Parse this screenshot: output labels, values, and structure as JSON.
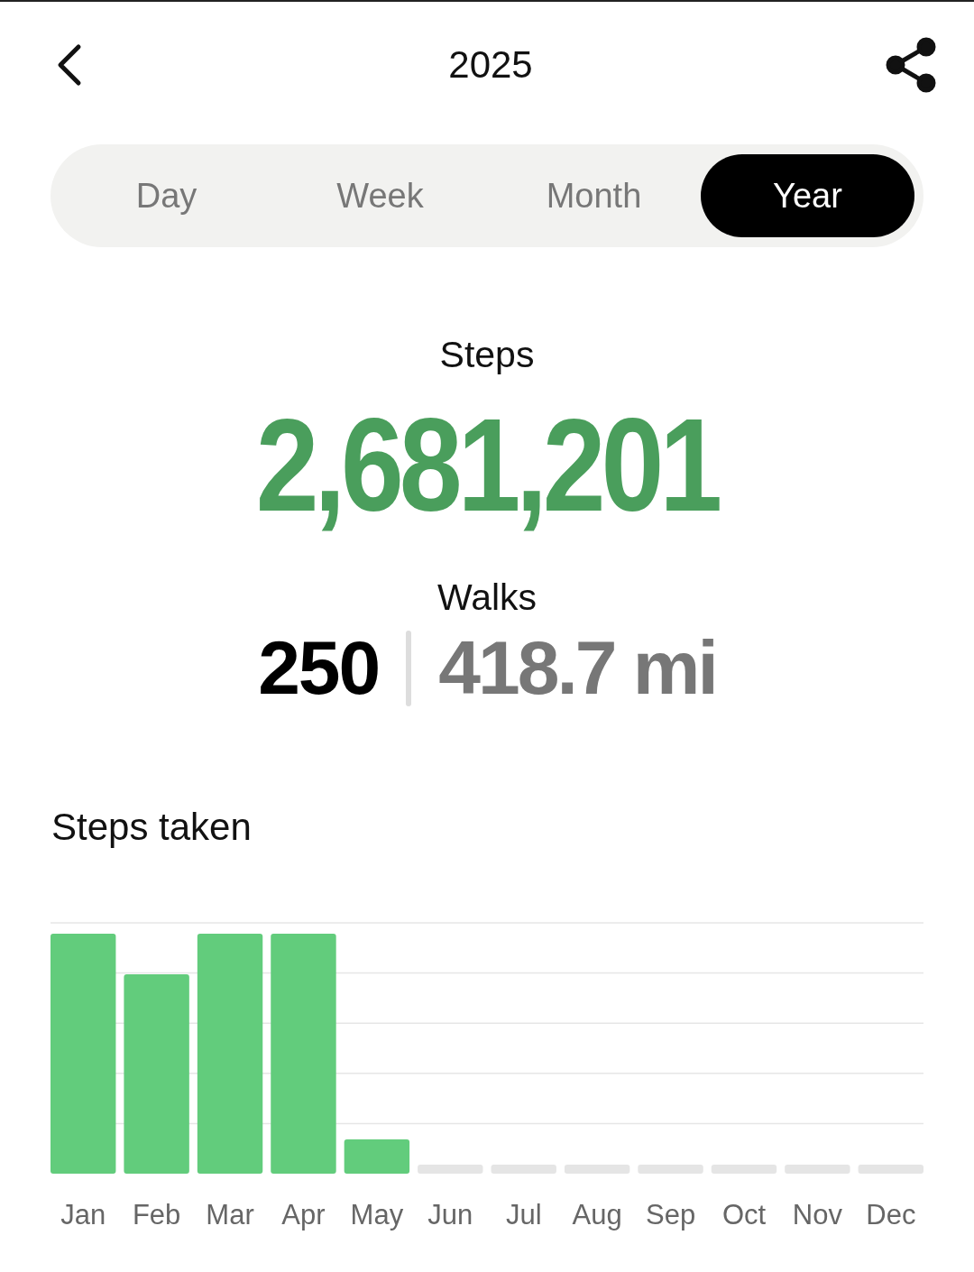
{
  "header": {
    "title": "2025"
  },
  "tabs": [
    {
      "label": "Day",
      "selected": false
    },
    {
      "label": "Week",
      "selected": false
    },
    {
      "label": "Month",
      "selected": false
    },
    {
      "label": "Year",
      "selected": true
    }
  ],
  "steps": {
    "label": "Steps",
    "value": "2,681,201"
  },
  "walks": {
    "label": "Walks",
    "count": "250",
    "distance": "418.7 mi"
  },
  "chart": {
    "title": "Steps taken",
    "months": [
      "Jan",
      "Feb",
      "Mar",
      "Apr",
      "May",
      "Jun",
      "Jul",
      "Aug",
      "Sep",
      "Oct",
      "Nov",
      "Dec"
    ]
  }
}
